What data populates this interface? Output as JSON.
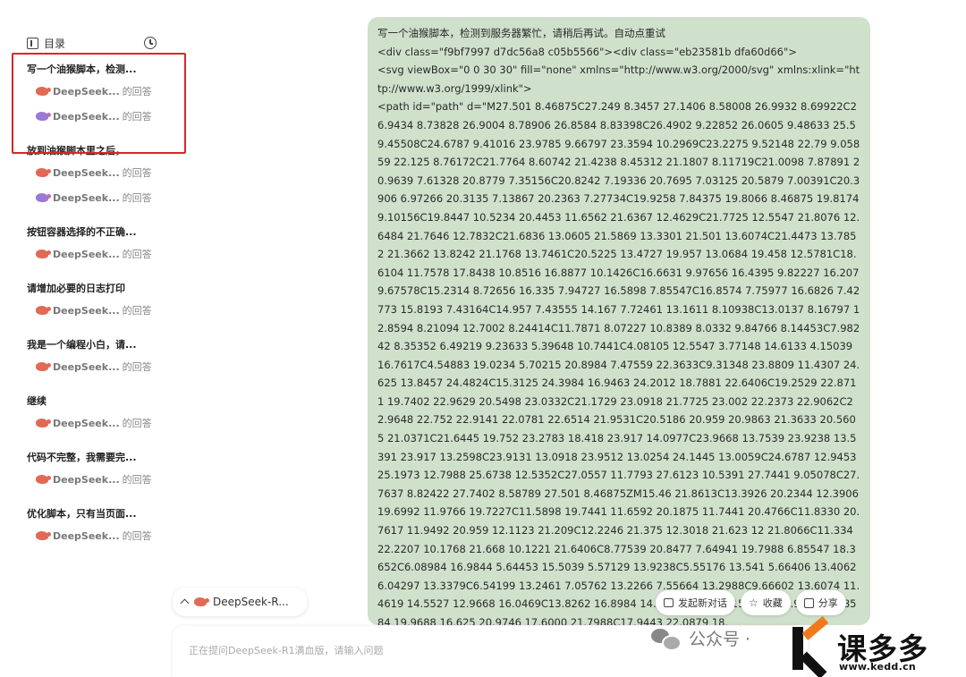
{
  "sidebar": {
    "title": "目录",
    "groups": [
      {
        "title": "写一个油猴脚本，检测...",
        "answers": [
          {
            "model": "DeepSeek...",
            "suffix": "的回答",
            "variant": "orange"
          },
          {
            "model": "DeepSeek...",
            "suffix": "的回答",
            "variant": "purple"
          }
        ]
      },
      {
        "title": "放到油猴脚本里之后，...",
        "answers": [
          {
            "model": "DeepSeek...",
            "suffix": "的回答",
            "variant": "orange"
          },
          {
            "model": "DeepSeek...",
            "suffix": "的回答",
            "variant": "purple"
          }
        ]
      },
      {
        "title": "按钮容器选择的不正确...",
        "answers": [
          {
            "model": "DeepSeek...",
            "suffix": "的回答",
            "variant": "orange"
          }
        ]
      },
      {
        "title": "请增加必要的日志打印",
        "answers": [
          {
            "model": "DeepSeek...",
            "suffix": "的回答",
            "variant": "orange"
          }
        ]
      },
      {
        "title": "我是一个编程小白，请...",
        "answers": [
          {
            "model": "DeepSeek...",
            "suffix": "的回答",
            "variant": "orange"
          }
        ]
      },
      {
        "title": "继续",
        "answers": [
          {
            "model": "DeepSeek...",
            "suffix": "的回答",
            "variant": "orange"
          }
        ]
      },
      {
        "title": "代码不完整，我需要完...",
        "answers": [
          {
            "model": "DeepSeek...",
            "suffix": "的回答",
            "variant": "orange"
          }
        ]
      },
      {
        "title": "优化脚本，只有当页面...",
        "answers": [
          {
            "model": "DeepSeek...",
            "suffix": "的回答",
            "variant": "orange"
          }
        ]
      }
    ]
  },
  "message": {
    "text": "写一个油猴脚本，检测到服务器繁忙，请稍后再试。自动点重试\n<div class=\"f9bf7997 d7dc56a8 c05b5566\"><div class=\"eb23581b dfa60d66\">\n<svg viewBox=\"0 0 30 30\" fill=\"none\" xmlns=\"http://www.w3.org/2000/svg\" xmlns:xlink=\"http://www.w3.org/1999/xlink\">\n<path id=\"path\" d=\"M27.501 8.46875C27.249 8.3457 27.1406 8.58008 26.9932 8.69922C26.9434 8.73828 26.9004 8.78906 26.8584 8.83398C26.4902 9.22852 26.0605 9.48633 25.5 9.45508C24.6787 9.41016 23.9785 9.66797 23.3594 10.2969C23.2275 9.52148 22.79 9.05859 22.125 8.76172C21.7764 8.60742 21.4238 8.45312 21.1807 8.11719C21.0098 7.87891 20.9639 7.61328 20.8779 7.35156C20.8242 7.19336 20.7695 7.03125 20.5879 7.00391C20.3906 6.97266 20.3135 7.13867 20.2363 7.27734C19.9258 7.84375 19.8066 8.46875 19.8174 9.10156C19.8447 10.5234 20.4453 11.6562 21.6367 12.4629C21.7725 12.5547 21.8076 12.6484 21.7646 12.7832C21.6836 13.0605 21.5869 13.3301 21.501 13.6074C21.4473 13.7852 21.3662 13.8242 21.1768 13.7461C20.5225 13.4727 19.957 13.0684 19.458 12.5781C18.6104 11.7578 17.8438 10.8516 16.8877 10.1426C16.6631 9.97656 16.4395 9.82227 16.207 9.67578C15.2314 8.72656 16.335 7.94727 16.5898 7.85547C16.8574 7.75977 16.6826 7.42773 15.8193 7.43164C14.957 7.43555 14.167 7.72461 13.1611 8.10938C13.0137 8.16797 12.8594 8.21094 12.7002 8.24414C11.7871 8.07227 10.8389 8.0332 9.84766 8.14453C7.98242 8.35352 6.49219 9.23633 5.39648 10.7441C4.08105 12.5547 3.77148 14.6133 4.15039 16.7617C4.54883 19.0234 5.70215 20.8984 7.47559 22.3633C9.31348 23.8809 11.4307 24.625 13.8457 24.4824C15.3125 24.3984 16.9463 24.2012 18.7881 22.6406C19.2529 22.8711 19.7402 22.9629 20.5498 23.0332C21.1729 23.0918 21.7725 23.002 22.2373 22.9062C22.9648 22.752 22.9141 22.0781 22.6514 21.9531C20.5186 20.959 20.9863 21.3633 20.5605 21.0371C21.6445 19.752 23.2783 18.418 23.917 14.0977C23.9668 13.7539 23.9238 13.5391 23.917 13.2598C23.9131 13.0918 23.9512 13.0254 24.1445 13.0059C24.6787 12.9453 25.1973 12.7988 25.6738 12.5352C27.0557 11.7793 27.6123 10.5391 27.7441 9.05078C27.7637 8.82422 27.7402 8.58789 27.501 8.46875ZM15.46 21.8613C13.3926 20.2344 12.3906 19.6992 11.9766 19.7227C11.5898 19.7441 11.6592 20.1875 11.7441 20.4766C11.8330 20.7617 11.9492 20.959 12.1123 21.209C12.2246 21.375 12.3018 21.623 12 21.8066C11.334 22.2207 10.1768 21.668 10.1221 21.6406C8.77539 20.8477 7.64941 19.7988 6.85547 18.3652C6.08984 16.9844 5.64453 15.5039 5.57129 13.9238C5.55176 13.541 5.66406 13.4062 6.04297 13.3379C6.54199 13.2461 7.05762 13.2266 7.55664 13.2988C9.66602 13.6074 11.4619 14.5527 12.9668 16.0469C13.8262 16.8984 14.4756 17.9141 15.1465 18.9121C15.8584 19.9688 16.625 20.9746 17.6000 21.7988C17.9443 22.0879 18."
  },
  "actions": {
    "new_chat": "发起新对话",
    "favorite": "收藏",
    "share": "分享"
  },
  "model_chip": {
    "label": "DeepSeek-R..."
  },
  "input": {
    "placeholder": "正在提问DeepSeek-R1满血版，请输入问题"
  },
  "watermark": {
    "wechat_label": "公众号 ·",
    "brand": "课多多",
    "url": "www.kedd.cn"
  }
}
